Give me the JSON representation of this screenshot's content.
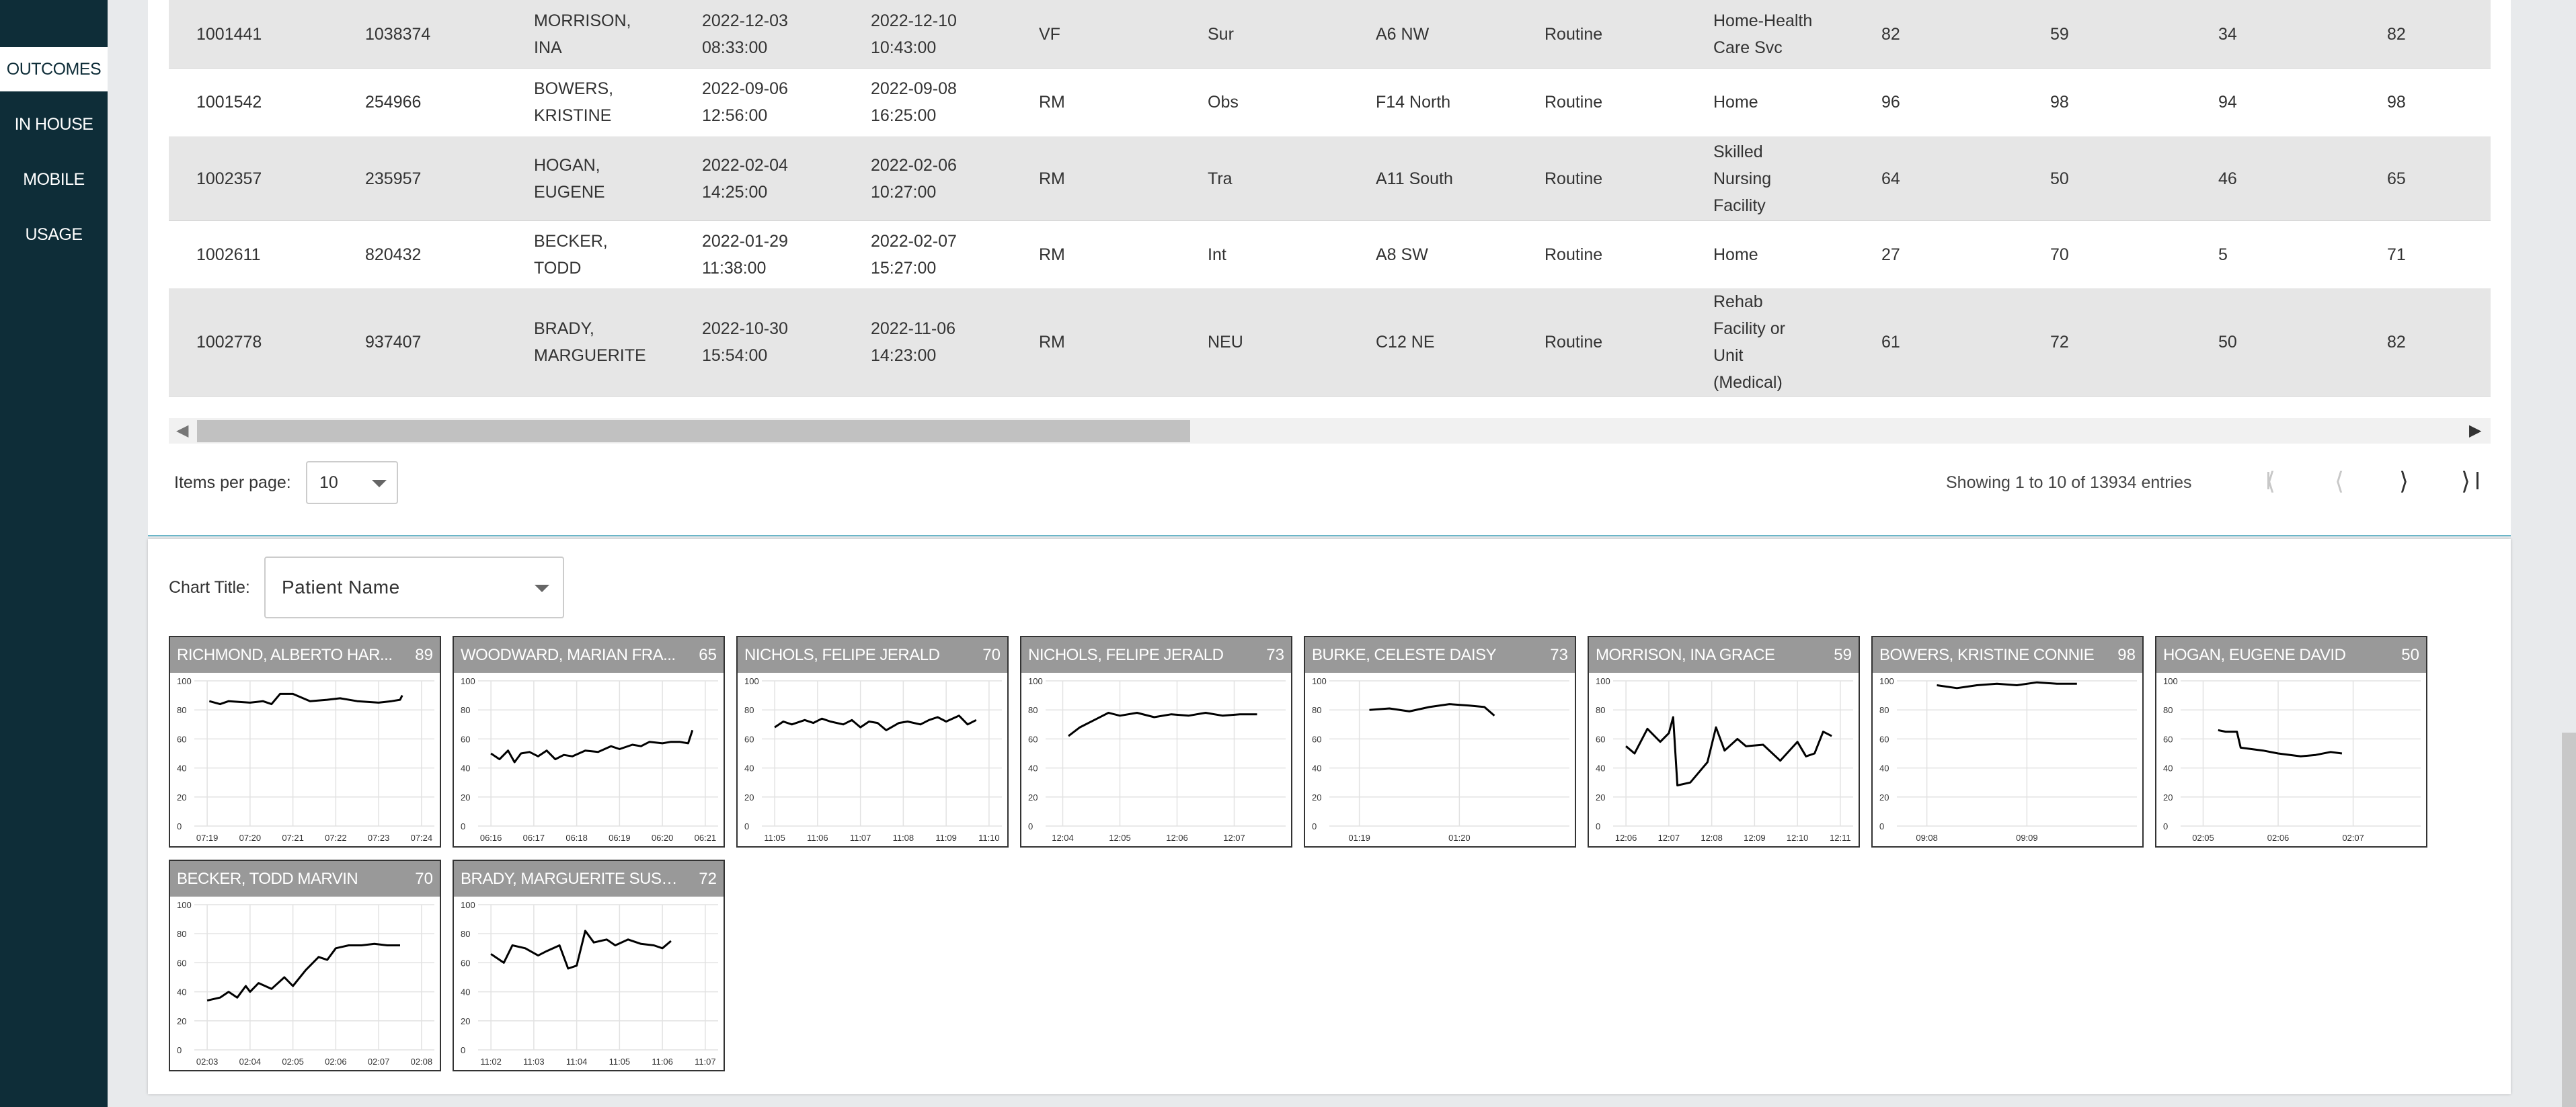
{
  "nav": {
    "items": [
      "OUTCOMES",
      "IN HOUSE",
      "MOBILE",
      "USAGE"
    ],
    "active": 0
  },
  "table": {
    "rows": [
      [
        [
          "1001441"
        ],
        [
          "1038374"
        ],
        [
          "MORRISON,",
          "INA"
        ],
        [
          "2022-12-03",
          "08:33:00"
        ],
        [
          "2022-12-10",
          "10:43:00"
        ],
        [
          "VF"
        ],
        [
          "Sur"
        ],
        [
          "A6 NW"
        ],
        [
          "Routine"
        ],
        [
          "Home-Health",
          "Care Svc"
        ],
        [
          "82"
        ],
        [
          "59"
        ],
        [
          "34"
        ],
        [
          "82"
        ]
      ],
      [
        [
          "1001542"
        ],
        [
          "254966"
        ],
        [
          "BOWERS,",
          "KRISTINE"
        ],
        [
          "2022-09-06",
          "12:56:00"
        ],
        [
          "2022-09-08",
          "16:25:00"
        ],
        [
          "RM"
        ],
        [
          "Obs"
        ],
        [
          "F14 North"
        ],
        [
          "Routine"
        ],
        [
          "Home"
        ],
        [
          "96"
        ],
        [
          "98"
        ],
        [
          "94"
        ],
        [
          "98"
        ]
      ],
      [
        [
          "1002357"
        ],
        [
          "235957"
        ],
        [
          "HOGAN,",
          "EUGENE"
        ],
        [
          "2022-02-04",
          "14:25:00"
        ],
        [
          "2022-02-06",
          "10:27:00"
        ],
        [
          "RM"
        ],
        [
          "Tra"
        ],
        [
          "A11 South"
        ],
        [
          "Routine"
        ],
        [
          "Skilled",
          "Nursing",
          "Facility"
        ],
        [
          "64"
        ],
        [
          "50"
        ],
        [
          "46"
        ],
        [
          "65"
        ]
      ],
      [
        [
          "1002611"
        ],
        [
          "820432"
        ],
        [
          "BECKER,",
          "TODD"
        ],
        [
          "2022-01-29",
          "11:38:00"
        ],
        [
          "2022-02-07",
          "15:27:00"
        ],
        [
          "RM"
        ],
        [
          "Int"
        ],
        [
          "A8 SW"
        ],
        [
          "Routine"
        ],
        [
          "Home"
        ],
        [
          "27"
        ],
        [
          "70"
        ],
        [
          "5"
        ],
        [
          "71"
        ]
      ],
      [
        [
          "1002778"
        ],
        [
          "937407"
        ],
        [
          "BRADY,",
          "MARGUERITE"
        ],
        [
          "2022-10-30",
          "15:54:00"
        ],
        [
          "2022-11-06",
          "14:23:00"
        ],
        [
          "RM"
        ],
        [
          "NEU"
        ],
        [
          "C12 NE"
        ],
        [
          "Routine"
        ],
        [
          "Rehab",
          "Facility or",
          "Unit",
          "(Medical)"
        ],
        [
          "61"
        ],
        [
          "72"
        ],
        [
          "50"
        ],
        [
          "82"
        ]
      ]
    ]
  },
  "pager": {
    "items_per_page_label": "Items per page:",
    "items_per_page_value": "10",
    "showing": "Showing 1 to 10 of 13934 entries",
    "first_icon": "first-page-icon",
    "prev_icon": "chevron-left-icon",
    "next_icon": "chevron-right-icon",
    "last_icon": "last-page-icon"
  },
  "chart_title": {
    "label": "Chart Title:",
    "value": "Patient Name"
  },
  "colors": {
    "sidebar": "#0e2d38",
    "accent": "#2e9aa6",
    "row_shade": "#e6e6e6",
    "chart_header": "#999999"
  },
  "chart_data": [
    {
      "type": "line",
      "title": "RICHMOND, ALBERTO HAR...",
      "value": "89",
      "ylim": [
        0,
        100
      ],
      "yticks": [
        "100",
        "80",
        "60",
        "40",
        "20",
        "0"
      ],
      "xticks": [
        "07:19",
        "07:20",
        "07:21",
        "07:22",
        "07:23",
        "07:24"
      ],
      "xlim": [
        0,
        5.6
      ],
      "x": [
        0.05,
        0.3,
        0.5,
        1.0,
        1.3,
        1.5,
        1.7,
        2.0,
        2.4,
        2.8,
        3.1,
        3.5,
        4.0,
        4.3,
        4.5,
        4.55
      ],
      "y": [
        86,
        84,
        86,
        85,
        86,
        84,
        91,
        91,
        86,
        87,
        88,
        86,
        85,
        86,
        87,
        90
      ]
    },
    {
      "type": "line",
      "title": "WOODWARD, MARIAN FRA...",
      "value": "65",
      "ylim": [
        0,
        100
      ],
      "yticks": [
        "100",
        "80",
        "60",
        "40",
        "20",
        "0"
      ],
      "xticks": [
        "06:16",
        "06:17",
        "06:18",
        "06:19",
        "06:20",
        "06:21"
      ],
      "xlim": [
        0,
        5.6
      ],
      "x": [
        0.0,
        0.2,
        0.4,
        0.55,
        0.7,
        0.9,
        1.1,
        1.3,
        1.5,
        1.7,
        1.9,
        2.2,
        2.5,
        2.8,
        3.0,
        3.3,
        3.5,
        3.7,
        4.0,
        4.2,
        4.4,
        4.6,
        4.7
      ],
      "y": [
        50,
        46,
        52,
        44,
        50,
        51,
        48,
        52,
        46,
        49,
        48,
        52,
        51,
        55,
        53,
        56,
        55,
        58,
        57,
        58,
        58,
        57,
        66
      ]
    },
    {
      "type": "line",
      "title": "NICHOLS, FELIPE JERALD",
      "value": "70",
      "ylim": [
        0,
        100
      ],
      "yticks": [
        "100",
        "80",
        "60",
        "40",
        "20",
        "0"
      ],
      "xticks": [
        "11:05",
        "11:06",
        "11:07",
        "11:08",
        "11:09",
        "11:10"
      ],
      "xlim": [
        0,
        5.6
      ],
      "x": [
        0.0,
        0.2,
        0.4,
        0.7,
        0.9,
        1.1,
        1.3,
        1.6,
        1.8,
        2.0,
        2.2,
        2.4,
        2.6,
        2.9,
        3.1,
        3.4,
        3.6,
        3.8,
        4.0,
        4.3,
        4.5,
        4.7
      ],
      "y": [
        68,
        72,
        70,
        73,
        71,
        74,
        72,
        70,
        73,
        68,
        72,
        71,
        66,
        71,
        72,
        70,
        73,
        75,
        72,
        76,
        70,
        73
      ]
    },
    {
      "type": "line",
      "title": "NICHOLS, FELIPE JERALD",
      "value": "73",
      "ylim": [
        0,
        100
      ],
      "yticks": [
        "100",
        "80",
        "60",
        "40",
        "20",
        "0"
      ],
      "xticks": [
        "12:04",
        "12:05",
        "12:06",
        "12:07"
      ],
      "xlim": [
        0,
        4.2
      ],
      "x": [
        0.1,
        0.3,
        0.6,
        0.8,
        1.0,
        1.3,
        1.6,
        1.9,
        2.2,
        2.5,
        2.8,
        3.1,
        3.4
      ],
      "y": [
        62,
        68,
        74,
        78,
        76,
        78,
        75,
        77,
        76,
        78,
        76,
        77,
        77
      ]
    },
    {
      "type": "line",
      "title": "BURKE, CELESTE DAISY",
      "value": "73",
      "ylim": [
        0,
        100
      ],
      "yticks": [
        "100",
        "80",
        "60",
        "40",
        "20",
        "0"
      ],
      "xticks": [
        "01:19",
        "01:20"
      ],
      "xlim": [
        0,
        2.4
      ],
      "x": [
        0.1,
        0.3,
        0.5,
        0.7,
        0.9,
        1.1,
        1.25,
        1.35
      ],
      "y": [
        80,
        81,
        79,
        82,
        84,
        83,
        82,
        76
      ]
    },
    {
      "type": "line",
      "title": "MORRISON, INA GRACE",
      "value": "59",
      "ylim": [
        0,
        100
      ],
      "yticks": [
        "100",
        "80",
        "60",
        "40",
        "20",
        "0"
      ],
      "xticks": [
        "12:06",
        "12:07",
        "12:08",
        "12:09",
        "12:10",
        "12:11"
      ],
      "xlim": [
        0,
        5.6
      ],
      "x": [
        0.0,
        0.2,
        0.5,
        0.8,
        1.0,
        1.1,
        1.2,
        1.5,
        1.9,
        2.1,
        2.3,
        2.6,
        2.8,
        3.2,
        3.6,
        4.0,
        4.2,
        4.4,
        4.6,
        4.8
      ],
      "y": [
        55,
        50,
        67,
        58,
        64,
        75,
        28,
        30,
        44,
        68,
        52,
        60,
        55,
        56,
        45,
        58,
        48,
        50,
        65,
        62
      ]
    },
    {
      "type": "line",
      "title": "BOWERS, KRISTINE CONNIE",
      "value": "98",
      "ylim": [
        0,
        100
      ],
      "yticks": [
        "100",
        "80",
        "60",
        "40",
        "20",
        "0"
      ],
      "xticks": [
        "09:08",
        "09:09"
      ],
      "xlim": [
        0,
        2.4
      ],
      "x": [
        0.1,
        0.3,
        0.5,
        0.7,
        0.9,
        1.1,
        1.3,
        1.5
      ],
      "y": [
        97,
        95,
        97,
        98,
        97,
        99,
        98,
        98
      ]
    },
    {
      "type": "line",
      "title": "HOGAN, EUGENE DAVID",
      "value": "50",
      "ylim": [
        0,
        100
      ],
      "yticks": [
        "100",
        "80",
        "60",
        "40",
        "20",
        "0"
      ],
      "xticks": [
        "02:05",
        "02:06",
        "02:07"
      ],
      "xlim": [
        0,
        3.2
      ],
      "x": [
        0.2,
        0.3,
        0.45,
        0.5,
        0.8,
        1.0,
        1.3,
        1.5,
        1.7,
        1.85
      ],
      "y": [
        66,
        65,
        65,
        54,
        52,
        50,
        48,
        49,
        51,
        50
      ]
    },
    {
      "type": "line",
      "title": "BECKER, TODD MARVIN",
      "value": "70",
      "ylim": [
        0,
        100
      ],
      "yticks": [
        "100",
        "80",
        "60",
        "40",
        "20",
        "0"
      ],
      "xticks": [
        "02:03",
        "02:04",
        "02:05",
        "02:06",
        "02:07",
        "02:08"
      ],
      "xlim": [
        0,
        5.6
      ],
      "x": [
        0.0,
        0.3,
        0.5,
        0.7,
        0.9,
        1.0,
        1.2,
        1.5,
        1.8,
        2.0,
        2.3,
        2.6,
        2.8,
        3.0,
        3.3,
        3.6,
        3.9,
        4.2,
        4.5
      ],
      "y": [
        34,
        36,
        40,
        36,
        44,
        40,
        46,
        42,
        50,
        44,
        55,
        64,
        62,
        70,
        72,
        72,
        73,
        72,
        72
      ]
    },
    {
      "type": "line",
      "title": "BRADY, MARGUERITE SUSAN",
      "value": "72",
      "ylim": [
        0,
        100
      ],
      "yticks": [
        "100",
        "80",
        "60",
        "40",
        "20",
        "0"
      ],
      "xticks": [
        "11:02",
        "11:03",
        "11:04",
        "11:05",
        "11:06",
        "11:07"
      ],
      "xlim": [
        0,
        5.6
      ],
      "x": [
        0.0,
        0.3,
        0.5,
        0.8,
        1.1,
        1.3,
        1.6,
        1.8,
        2.0,
        2.2,
        2.4,
        2.7,
        2.9,
        3.2,
        3.5,
        3.8,
        4.0,
        4.2
      ],
      "y": [
        66,
        60,
        72,
        70,
        65,
        68,
        72,
        56,
        58,
        82,
        74,
        76,
        72,
        76,
        73,
        72,
        70,
        75
      ]
    }
  ]
}
